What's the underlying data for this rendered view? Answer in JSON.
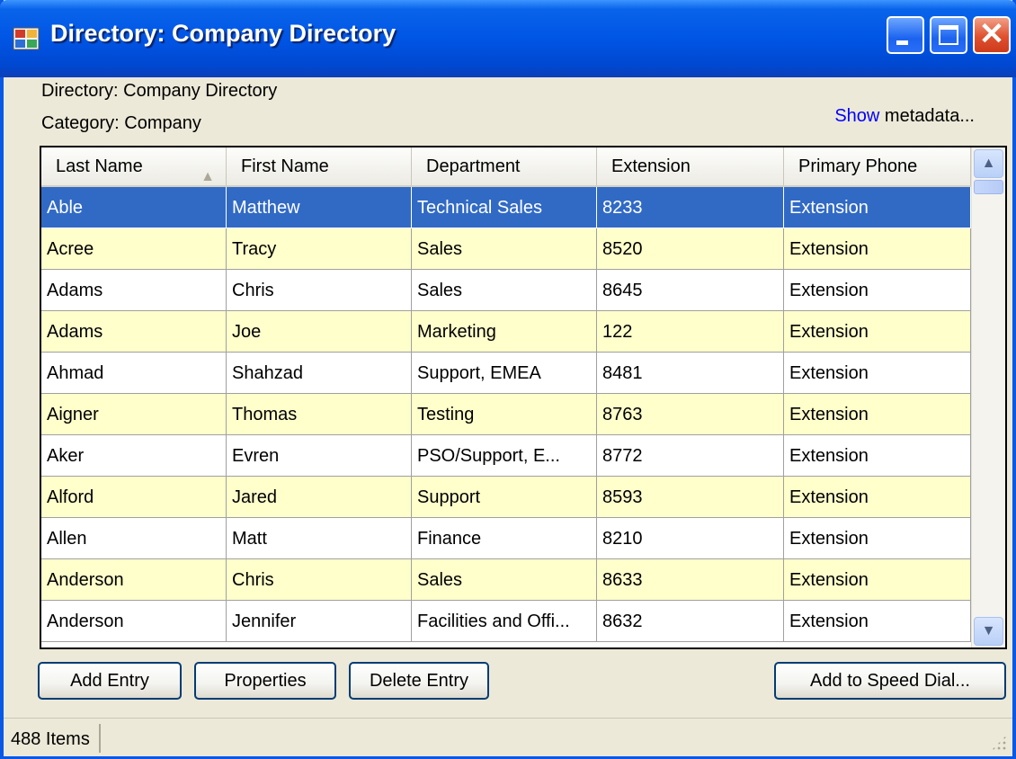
{
  "window": {
    "title": "Directory: Company Directory",
    "controls": {
      "minimize": "minimize",
      "maximize": "maximize",
      "close": "✕"
    }
  },
  "info": {
    "directory_line": "Directory: Company Directory",
    "category_line": "Category: Company",
    "meta_show": "Show",
    "meta_rest": " metadata..."
  },
  "grid": {
    "columns": [
      "Last Name",
      "First Name",
      "Department",
      "Extension",
      "Primary Phone"
    ],
    "sort_indicator": "▲",
    "rows": [
      {
        "last": "Able",
        "first": "Matthew",
        "dept": "Technical Sales",
        "ext": "8233",
        "phone": "Extension"
      },
      {
        "last": "Acree",
        "first": "Tracy",
        "dept": "Sales",
        "ext": "8520",
        "phone": "Extension"
      },
      {
        "last": "Adams",
        "first": "Chris",
        "dept": "Sales",
        "ext": "8645",
        "phone": "Extension"
      },
      {
        "last": "Adams",
        "first": "Joe",
        "dept": "Marketing",
        "ext": "122",
        "phone": "Extension"
      },
      {
        "last": "Ahmad",
        "first": "Shahzad",
        "dept": "Support, EMEA",
        "ext": "8481",
        "phone": "Extension"
      },
      {
        "last": "Aigner",
        "first": "Thomas",
        "dept": "Testing",
        "ext": "8763",
        "phone": "Extension"
      },
      {
        "last": "Aker",
        "first": "Evren",
        "dept": "PSO/Support, E...",
        "ext": "8772",
        "phone": "Extension"
      },
      {
        "last": "Alford",
        "first": "Jared",
        "dept": "Support",
        "ext": "8593",
        "phone": "Extension"
      },
      {
        "last": "Allen",
        "first": "Matt",
        "dept": "Finance",
        "ext": "8210",
        "phone": "Extension"
      },
      {
        "last": "Anderson",
        "first": "Chris",
        "dept": "Sales",
        "ext": "8633",
        "phone": "Extension"
      },
      {
        "last": "Anderson",
        "first": "Jennifer",
        "dept": "Facilities and Offi...",
        "ext": "8632",
        "phone": "Extension"
      }
    ],
    "scroll_up": "▲",
    "scroll_down": "▼"
  },
  "buttons": {
    "add_entry": "Add Entry",
    "properties": "Properties",
    "delete_entry": "Delete Entry",
    "speed_dial": "Add to Speed Dial..."
  },
  "status": {
    "count": "488 Items"
  },
  "colors": {
    "title_bar": "#0055e5",
    "selection": "#316ac5",
    "alt_row": "#ffffcc",
    "link": "#0000ff"
  }
}
